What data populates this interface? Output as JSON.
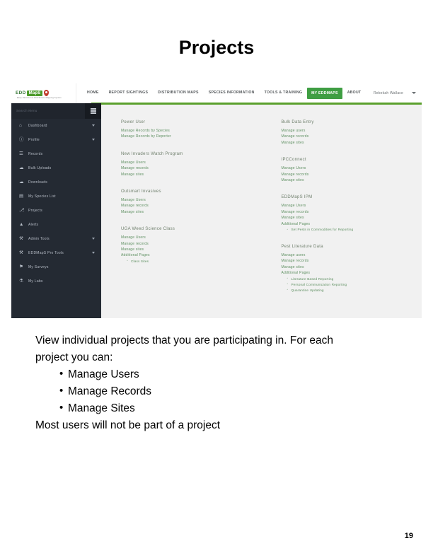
{
  "slide": {
    "title": "Projects",
    "page_number": "19"
  },
  "screenshot": {
    "navbar": {
      "brand": {
        "edd": "EDD",
        "maps": "MapS",
        "tagline": "Early Detection & Distribution Mapping System",
        "pin_icon": "map-pin-icon"
      },
      "links": [
        {
          "label": "HOME",
          "active": false
        },
        {
          "label": "REPORT SIGHTINGS",
          "active": false
        },
        {
          "label": "DISTRIBUTION MAPS",
          "active": false
        },
        {
          "label": "SPECIES INFORMATION",
          "active": false
        },
        {
          "label": "TOOLS & TRAINING",
          "active": false
        },
        {
          "label": "MY EDDMAPS",
          "active": true
        },
        {
          "label": "ABOUT",
          "active": false
        }
      ],
      "user_menu": {
        "label": "Rebekah Wallace",
        "caret_icon": "chevron-down-icon"
      }
    },
    "sidebar": {
      "search_placeholder": "Search Menu",
      "hamburger_icon": "hamburger-icon",
      "items": [
        {
          "label": "Dashboard",
          "icon": "home-icon",
          "glyph": "⌂",
          "expandable": true
        },
        {
          "label": "Profile",
          "icon": "user-icon",
          "glyph": "ⓘ",
          "expandable": true
        },
        {
          "label": "Records",
          "icon": "document-icon",
          "glyph": "☰",
          "expandable": false
        },
        {
          "label": "Bulk Uploads",
          "icon": "cloud-upload-icon",
          "glyph": "☁",
          "expandable": false
        },
        {
          "label": "Downloads",
          "icon": "cloud-download-icon",
          "glyph": "☁",
          "expandable": false
        },
        {
          "label": "My Species List",
          "icon": "clipboard-icon",
          "glyph": "▤",
          "expandable": false
        },
        {
          "label": "Projects",
          "icon": "sitemap-icon",
          "glyph": "⎇",
          "expandable": false
        },
        {
          "label": "Alerts",
          "icon": "bell-icon",
          "glyph": "▲",
          "expandable": false
        },
        {
          "label": "Admin Tools",
          "icon": "wrench-icon",
          "glyph": "⚒",
          "expandable": true
        },
        {
          "label": "EDDMapS Pro Tools",
          "icon": "wrench-icon",
          "glyph": "⚒",
          "expandable": true
        },
        {
          "label": "My Surveys",
          "icon": "survey-icon",
          "glyph": "⚑",
          "expandable": false
        },
        {
          "label": "My Labs",
          "icon": "flask-icon",
          "glyph": "⚗",
          "expandable": false
        }
      ]
    },
    "projects": {
      "left_column": [
        {
          "title": "Power User",
          "links": [
            "Manage Records by Species",
            "Manage Records by Reporter"
          ],
          "additional_label": null,
          "sub_links": []
        },
        {
          "title": "New Invaders Watch Program",
          "links": [
            "Manage Users",
            "Manage records",
            "Manage sites"
          ],
          "additional_label": null,
          "sub_links": []
        },
        {
          "title": "Outsmart Invasives",
          "links": [
            "Manage Users",
            "Manage records",
            "Manage sites"
          ],
          "additional_label": null,
          "sub_links": []
        },
        {
          "title": "UGA Weed Science Class",
          "links": [
            "Manage Users",
            "Manage records",
            "Manage sites"
          ],
          "additional_label": "Additional Pages",
          "sub_links": [
            "Class Sites"
          ]
        }
      ],
      "right_column": [
        {
          "title": "Bulk Data Entry",
          "links": [
            "Manage users",
            "Manage records",
            "Manage sites"
          ],
          "additional_label": null,
          "sub_links": []
        },
        {
          "title": "IPCConnect",
          "links": [
            "Manage Users",
            "Manage records",
            "Manage sites"
          ],
          "additional_label": null,
          "sub_links": []
        },
        {
          "title": "EDDMapS IPM",
          "links": [
            "Manage Users",
            "Manage records",
            "Manage sites"
          ],
          "additional_label": "Additional Pages",
          "sub_links": [
            "Set Pests in Commodities for Reporting"
          ]
        },
        {
          "title": "Pest Literature Data",
          "links": [
            "Manage users",
            "Manage records",
            "Manage sites"
          ],
          "additional_label": "Additional Pages",
          "sub_links": [
            "Literature Based Reporting",
            "Personal Communication Reporting",
            "Quarantine Updating"
          ]
        }
      ]
    }
  },
  "body": {
    "intro_line1": "View individual projects that you are participating in. For each",
    "intro_line2": "project you can:",
    "bullets": [
      "Manage Users",
      "Manage Records",
      "Manage Sites"
    ],
    "closing": "Most users will not be part of a project"
  },
  "colors": {
    "accent_green": "#5aa02c",
    "nav_active_green": "#3f9e43",
    "sidebar_dark": "#242a33",
    "content_bg": "#f1f1f1",
    "link_green": "#5d8f60"
  }
}
